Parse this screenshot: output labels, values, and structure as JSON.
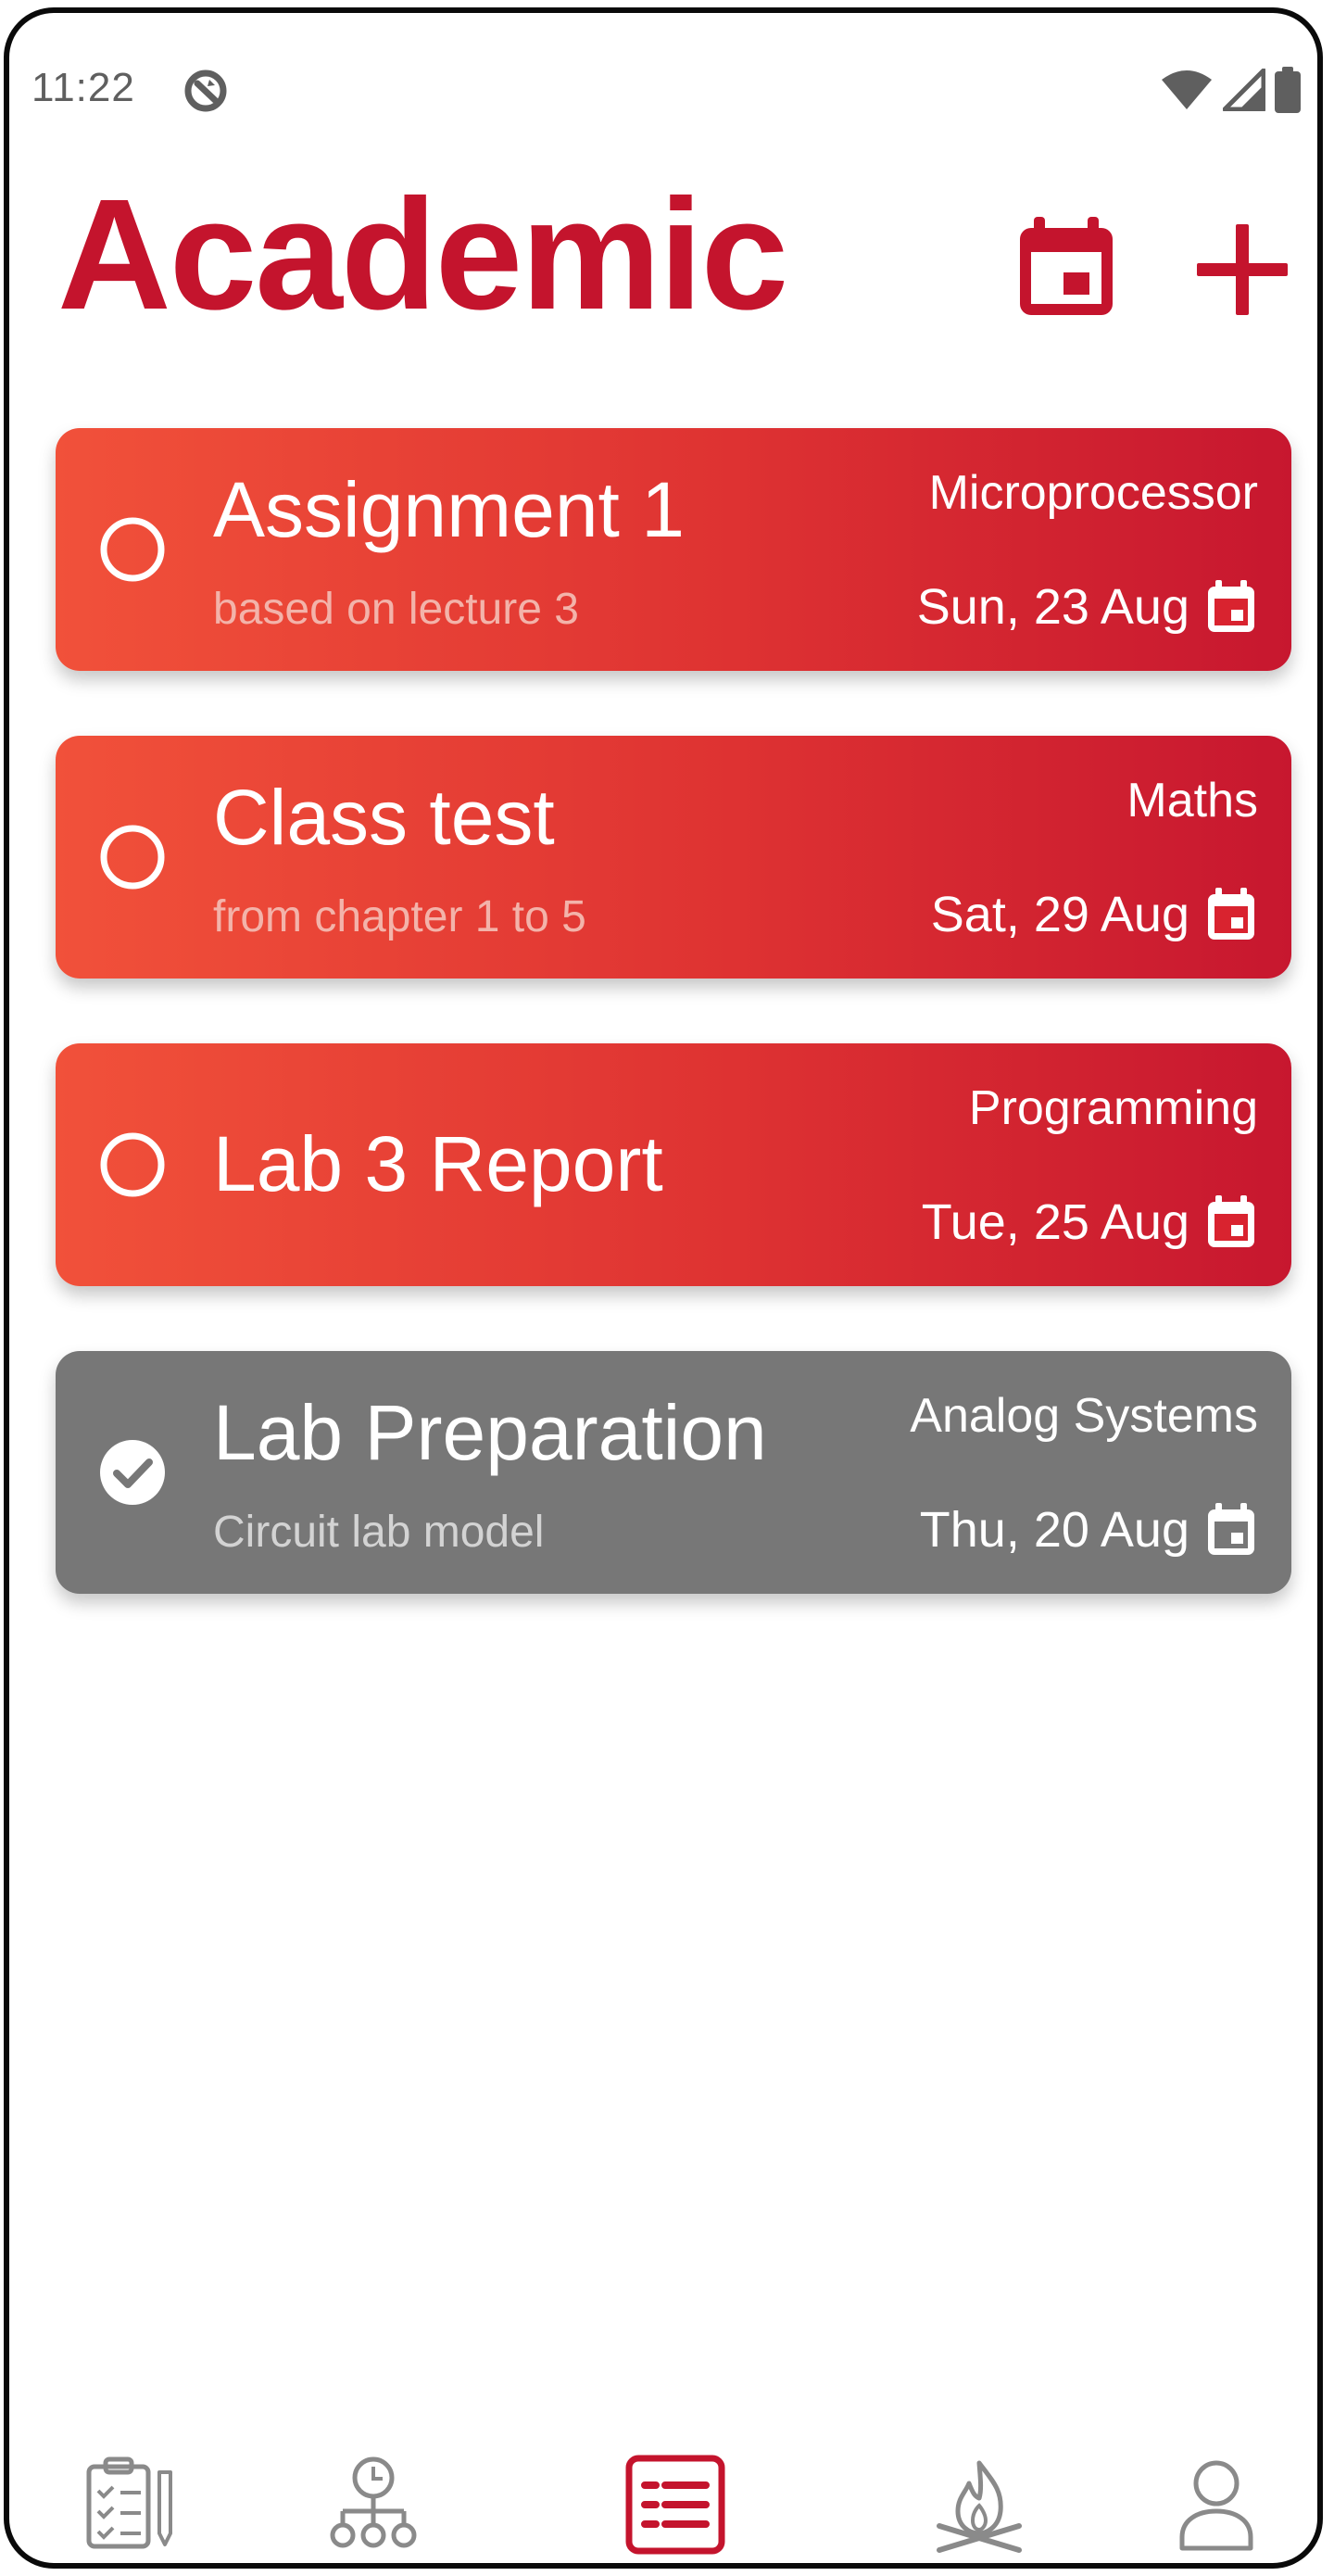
{
  "status_bar": {
    "time": "11:22"
  },
  "header": {
    "title": "Academic"
  },
  "tasks": [
    {
      "title": "Assignment 1",
      "description": "based on lecture 3",
      "subject": "Microprocessor",
      "date": "Sun, 23 Aug",
      "completed": false
    },
    {
      "title": "Class test",
      "description": "from chapter 1 to 5",
      "subject": "Maths",
      "date": "Sat, 29 Aug",
      "completed": false
    },
    {
      "title": "Lab 3 Report",
      "description": "",
      "subject": "Programming",
      "date": "Tue, 25 Aug",
      "completed": false
    },
    {
      "title": "Lab Preparation",
      "description": "Circuit lab model",
      "subject": "Analog Systems",
      "date": "Thu, 20 Aug",
      "completed": true
    }
  ],
  "bottom_nav": {
    "items": [
      "checklist-icon",
      "timeline-icon",
      "list-icon",
      "campfire-icon",
      "profile-icon"
    ],
    "active_index": 2
  },
  "colors": {
    "accent": "#c4142d",
    "card_gradient_start": "#f1513a",
    "card_gradient_end": "#c7172f",
    "completed_card": "#777777",
    "nav_inactive": "#8a8a8a"
  }
}
